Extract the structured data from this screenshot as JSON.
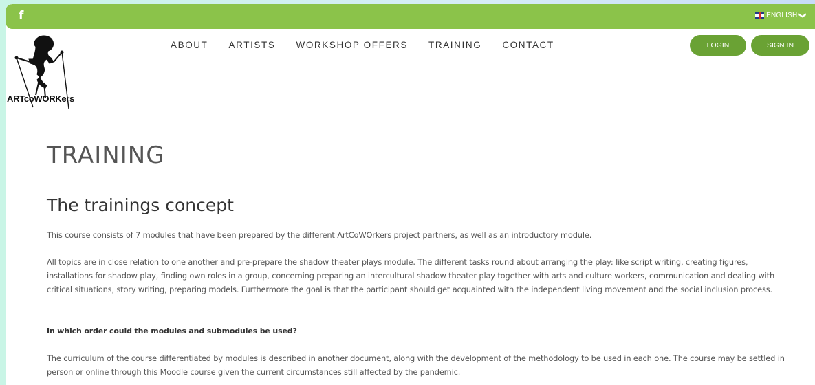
{
  "topbar": {
    "facebook_icon": "f",
    "language_label": "ENGLISH",
    "language_chevron": "❯"
  },
  "brand": {
    "name": "ARTcoWORKers"
  },
  "nav": {
    "items": [
      "ABOUT",
      "ARTISTS",
      "WORKSHOP OFFERS",
      "TRAINING",
      "CONTACT"
    ]
  },
  "auth": {
    "login": "LOGIN",
    "signin": "SIGN IN"
  },
  "content": {
    "title": "TRAINING",
    "subtitle": "The trainings concept",
    "p1": "This course consists of 7 modules that have been prepared by the different ArtCoWOrkers project partners, as well as an introductory module.",
    "p2": "All topics are in close relation to one another and pre-prepare the shadow theater plays module. The different tasks round about arranging the play: like script writing, creating figures, installations for shadow play, finding own roles in a group, concerning preparing an intercultural shadow theater play together with arts and culture workers, communication and dealing with critical situations, story writing, preparing models. Furthermore the goal is that the participant  should get acquainted with the independent living movement and the social inclusion process.",
    "question": "In which order could the modules and submodules be used?",
    "p3": "The curriculum of the course differentiated by modules is described in another document, along with the development of the methodology to be used in each one. The course may be settled in person or  online through this Moodle course given the current circumstances still affected by the pandemic."
  },
  "colors": {
    "topbar": "#8bc34a",
    "button": "#6aa234",
    "title_rule": "#3b56a3"
  }
}
